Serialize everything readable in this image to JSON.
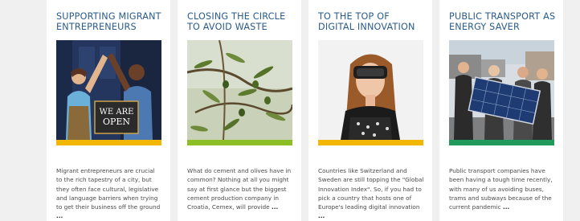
{
  "cards": [
    {
      "title": "SUPPORTING MIGRANT ENTREPRENEURS",
      "image_icon": "migrant-entrepreneurs-photo",
      "accent_color": "#f2b705",
      "excerpt": "Migrant entrepreneurs are crucial to the rich tapestry of a city, but they often face cultural, legislative and language barriers when trying to get their business off the ground",
      "read_more": "..."
    },
    {
      "title": "CLOSING THE CIRCLE TO AVOID WASTE",
      "image_icon": "olive-branch-photo",
      "accent_color": "#8cbf26",
      "excerpt": "What do cement and olives have in common? Nothing at all you might say at first glance but the biggest cement production company in Croatia, Cemex, will provide",
      "read_more": "..."
    },
    {
      "title": "TO THE TOP OF DIGITAL INNOVATION",
      "image_icon": "vr-headset-photo",
      "accent_color": "#f2b705",
      "excerpt": "Countries like Switzerland and Sweden are still topping the \"Global Innovation Index\". So, if you had to pick a country that hosts one of Europe's leading digital innovation",
      "read_more": "..."
    },
    {
      "title": "PUBLIC TRANSPORT AS ENERGY SAVER",
      "image_icon": "solar-panel-group-photo",
      "accent_color": "#1f9a5a",
      "excerpt": "Public transport companies have been having a tough time recently, with many of us avoiding buses, trams and subways because of the current pandemic",
      "read_more": "..."
    }
  ]
}
